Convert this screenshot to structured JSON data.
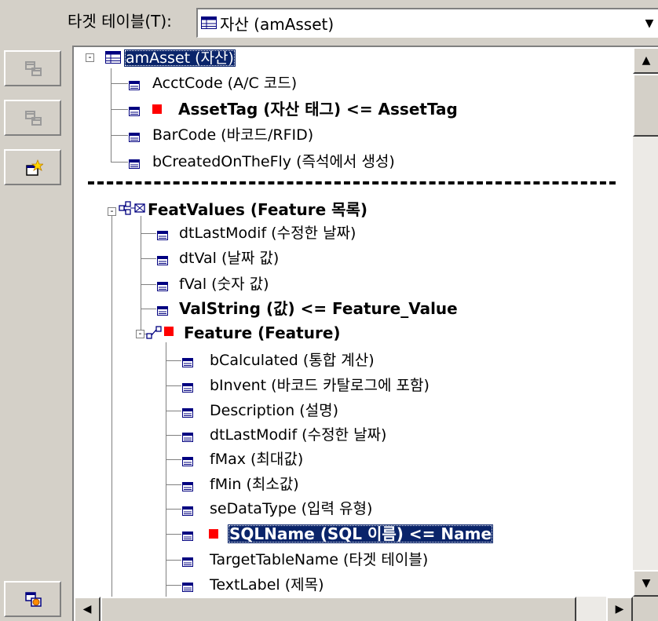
{
  "target": {
    "label": "타겟 테이블(T):",
    "value": "자산 (amAsset)"
  },
  "toolbar": {
    "buttons": [
      "disabled-copy-icon",
      "disabled-copy-icon",
      "new-field-icon",
      "refresh-icon"
    ]
  },
  "tree": {
    "root": {
      "label": "amAsset (자산)",
      "expander": "-"
    },
    "root_fields": [
      {
        "label": "AcctCode (A/C 코드)",
        "mapped": false
      },
      {
        "label": "AssetTag (자산 태그)  <=  AssetTag",
        "mapped": true
      },
      {
        "label": "BarCode (바코드/RFID)",
        "mapped": false
      },
      {
        "label": "bCreatedOnTheFly (즉석에서 생성)",
        "mapped": false
      }
    ],
    "featvalues": {
      "label": "FeatValues (Feature 목록)",
      "expander": "-",
      "fields": [
        {
          "label": "dtLastModif (수정한 날짜)",
          "mapped": false
        },
        {
          "label": "dtVal (날짜 값)",
          "mapped": false
        },
        {
          "label": "fVal (숫자 값)",
          "mapped": false
        },
        {
          "label": "ValString (값)  <=  Feature_Value",
          "mapped": true
        }
      ]
    },
    "feature": {
      "label": "Feature (Feature)",
      "expander": "-",
      "fields": [
        {
          "label": "bCalculated (통합 계산)",
          "mapped": false
        },
        {
          "label": "bInvent (바코드 카탈로그에 포함)",
          "mapped": false
        },
        {
          "label": "Description (설명)",
          "mapped": false
        },
        {
          "label": "dtLastModif (수정한 날짜)",
          "mapped": false
        },
        {
          "label": "fMax (최대값)",
          "mapped": false
        },
        {
          "label": "fMin (최소값)",
          "mapped": false
        },
        {
          "label": "seDataType (입력 유형)",
          "mapped": false
        },
        {
          "label": "SQLName (SQL 이름)  <=  Name",
          "mapped": true,
          "selected": true
        },
        {
          "label": "TargetTableName (타겟 테이블)",
          "mapped": false
        },
        {
          "label": "TextLabel (제목)",
          "mapped": false
        }
      ]
    }
  },
  "scrollbars": {
    "up_arrow": "▲",
    "down_arrow": "▼",
    "left_arrow": "◀",
    "right_arrow": "▶",
    "combo_arrow": "▼"
  },
  "colors": {
    "mapped_marker": "#ff0000",
    "selection": "#0a246a",
    "window_bg": "#d4d0c8"
  }
}
